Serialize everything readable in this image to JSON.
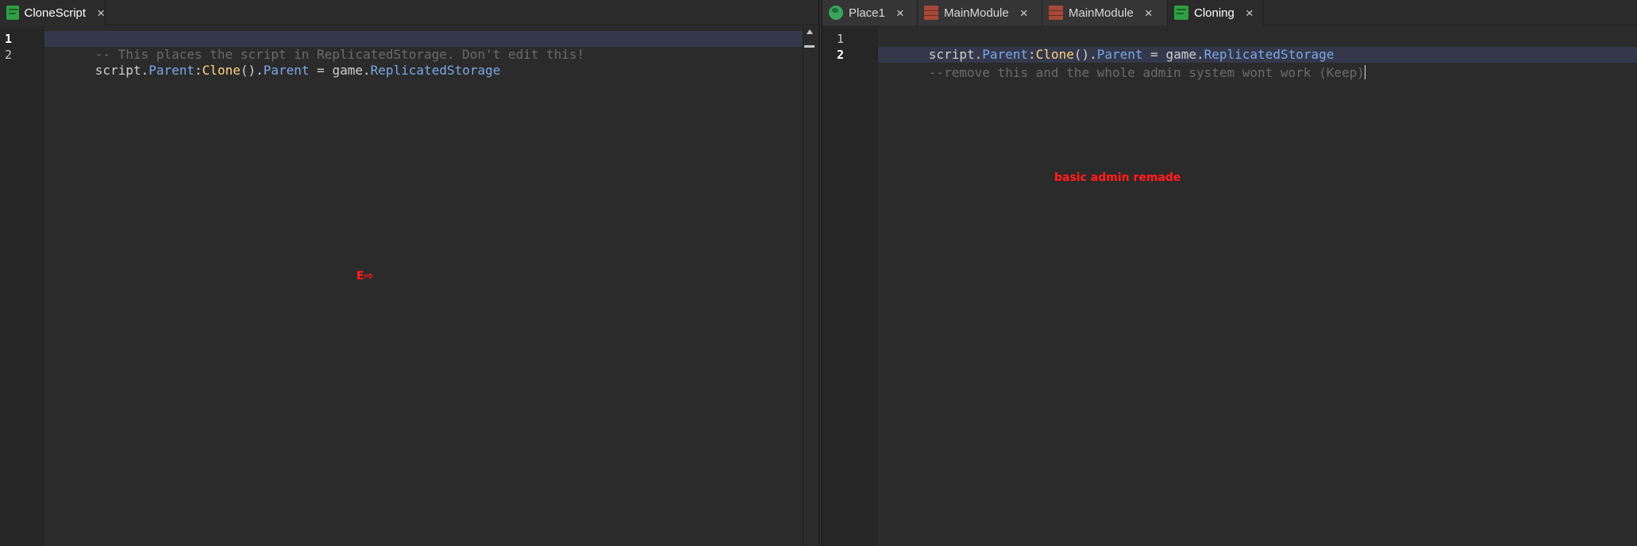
{
  "left_pane": {
    "tab": {
      "label": "CloneScript",
      "icon": "script-icon",
      "close": "×"
    },
    "line_numbers": [
      "1",
      "2"
    ],
    "lines": [
      {
        "comment": "-- This places the script in ReplicatedStorage. Don't edit this!"
      },
      {
        "t1": "script",
        "t2": ".",
        "t3": "Parent",
        "t4": ":",
        "t5": "Clone",
        "t6": "().",
        "t7": "Parent",
        "t8": " = ",
        "t9": "game",
        "t10": ".",
        "t11": "ReplicatedStorage"
      }
    ],
    "overlay_label": "E⇨"
  },
  "right_pane": {
    "tabs": [
      {
        "label": "Place1",
        "icon": "place-icon",
        "close": "×"
      },
      {
        "label": "MainModule",
        "icon": "module-icon",
        "close": "×"
      },
      {
        "label": "MainModule",
        "icon": "module-icon",
        "close": "×"
      },
      {
        "label": "Cloning",
        "icon": "script-icon",
        "close": "×"
      }
    ],
    "line_numbers": [
      "1",
      "2"
    ],
    "lines": [
      {
        "t1": "script",
        "t2": ".",
        "t3": "Parent",
        "t4": ":",
        "t5": "Clone",
        "t6": "().",
        "t7": "Parent",
        "t8": " = ",
        "t9": "game",
        "t10": ".",
        "t11": "ReplicatedStorage"
      },
      {
        "comment": "--remove this and the whole admin system wont work (Keep)"
      }
    ],
    "overlay_label": "basic admin remade"
  },
  "colors": {
    "background": "#2b2b2b",
    "gutter": "#262626",
    "comment": "#6b6b6b",
    "field": "#7ca8e6",
    "call": "#ffd37f",
    "highlight": "#34384a",
    "overlay_text": "#ff2020"
  }
}
